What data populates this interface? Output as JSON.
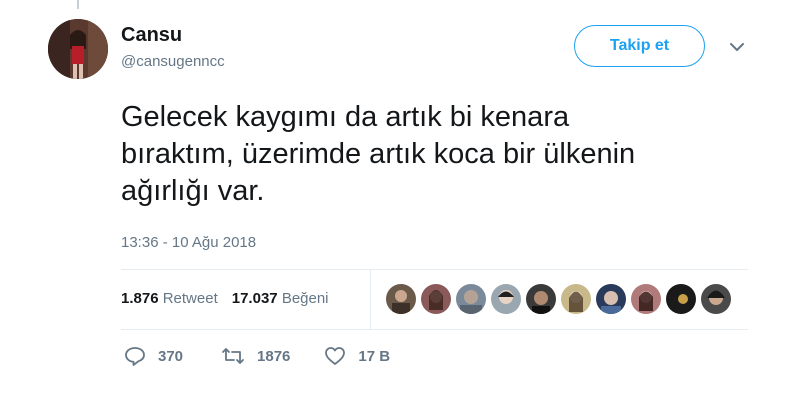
{
  "author": {
    "name": "Cansu",
    "handle": "@cansugenncc",
    "avatar_icon": "profile-photo"
  },
  "follow_button": {
    "label": "Takip et"
  },
  "tweet": {
    "lines": [
      "Gelecek kaygımı da artık bi kenara",
      "bıraktım, üzerimde artık koca bir ülkenin",
      "ağırlığı var."
    ],
    "timestamp": "13:36 - 10 Ağu 2018"
  },
  "stats": {
    "retweets_count": "1.876",
    "retweets_label": "Retweet",
    "likes_count": "17.037",
    "likes_label": "Beğeni"
  },
  "likers": [
    {
      "icon": "avatar-1",
      "color": "#6b5a4a"
    },
    {
      "icon": "avatar-2",
      "color": "#8a5a5a"
    },
    {
      "icon": "avatar-3",
      "color": "#7a8a9a"
    },
    {
      "icon": "avatar-4",
      "color": "#9aa7b0"
    },
    {
      "icon": "avatar-5",
      "color": "#3a3a3a"
    },
    {
      "icon": "avatar-6",
      "color": "#c8b88a"
    },
    {
      "icon": "avatar-7",
      "color": "#2a3a5a"
    },
    {
      "icon": "avatar-8",
      "color": "#b07a7a"
    },
    {
      "icon": "avatar-9",
      "color": "#1a1a1a"
    },
    {
      "icon": "avatar-10",
      "color": "#4a4a4a"
    }
  ],
  "actions": {
    "reply_count": "370",
    "retweet_count": "1876",
    "like_count": "17 B"
  },
  "colors": {
    "accent": "#1da1f2",
    "secondary_text": "#657786",
    "primary_text": "#14171a",
    "divider": "#e6ecf0"
  }
}
